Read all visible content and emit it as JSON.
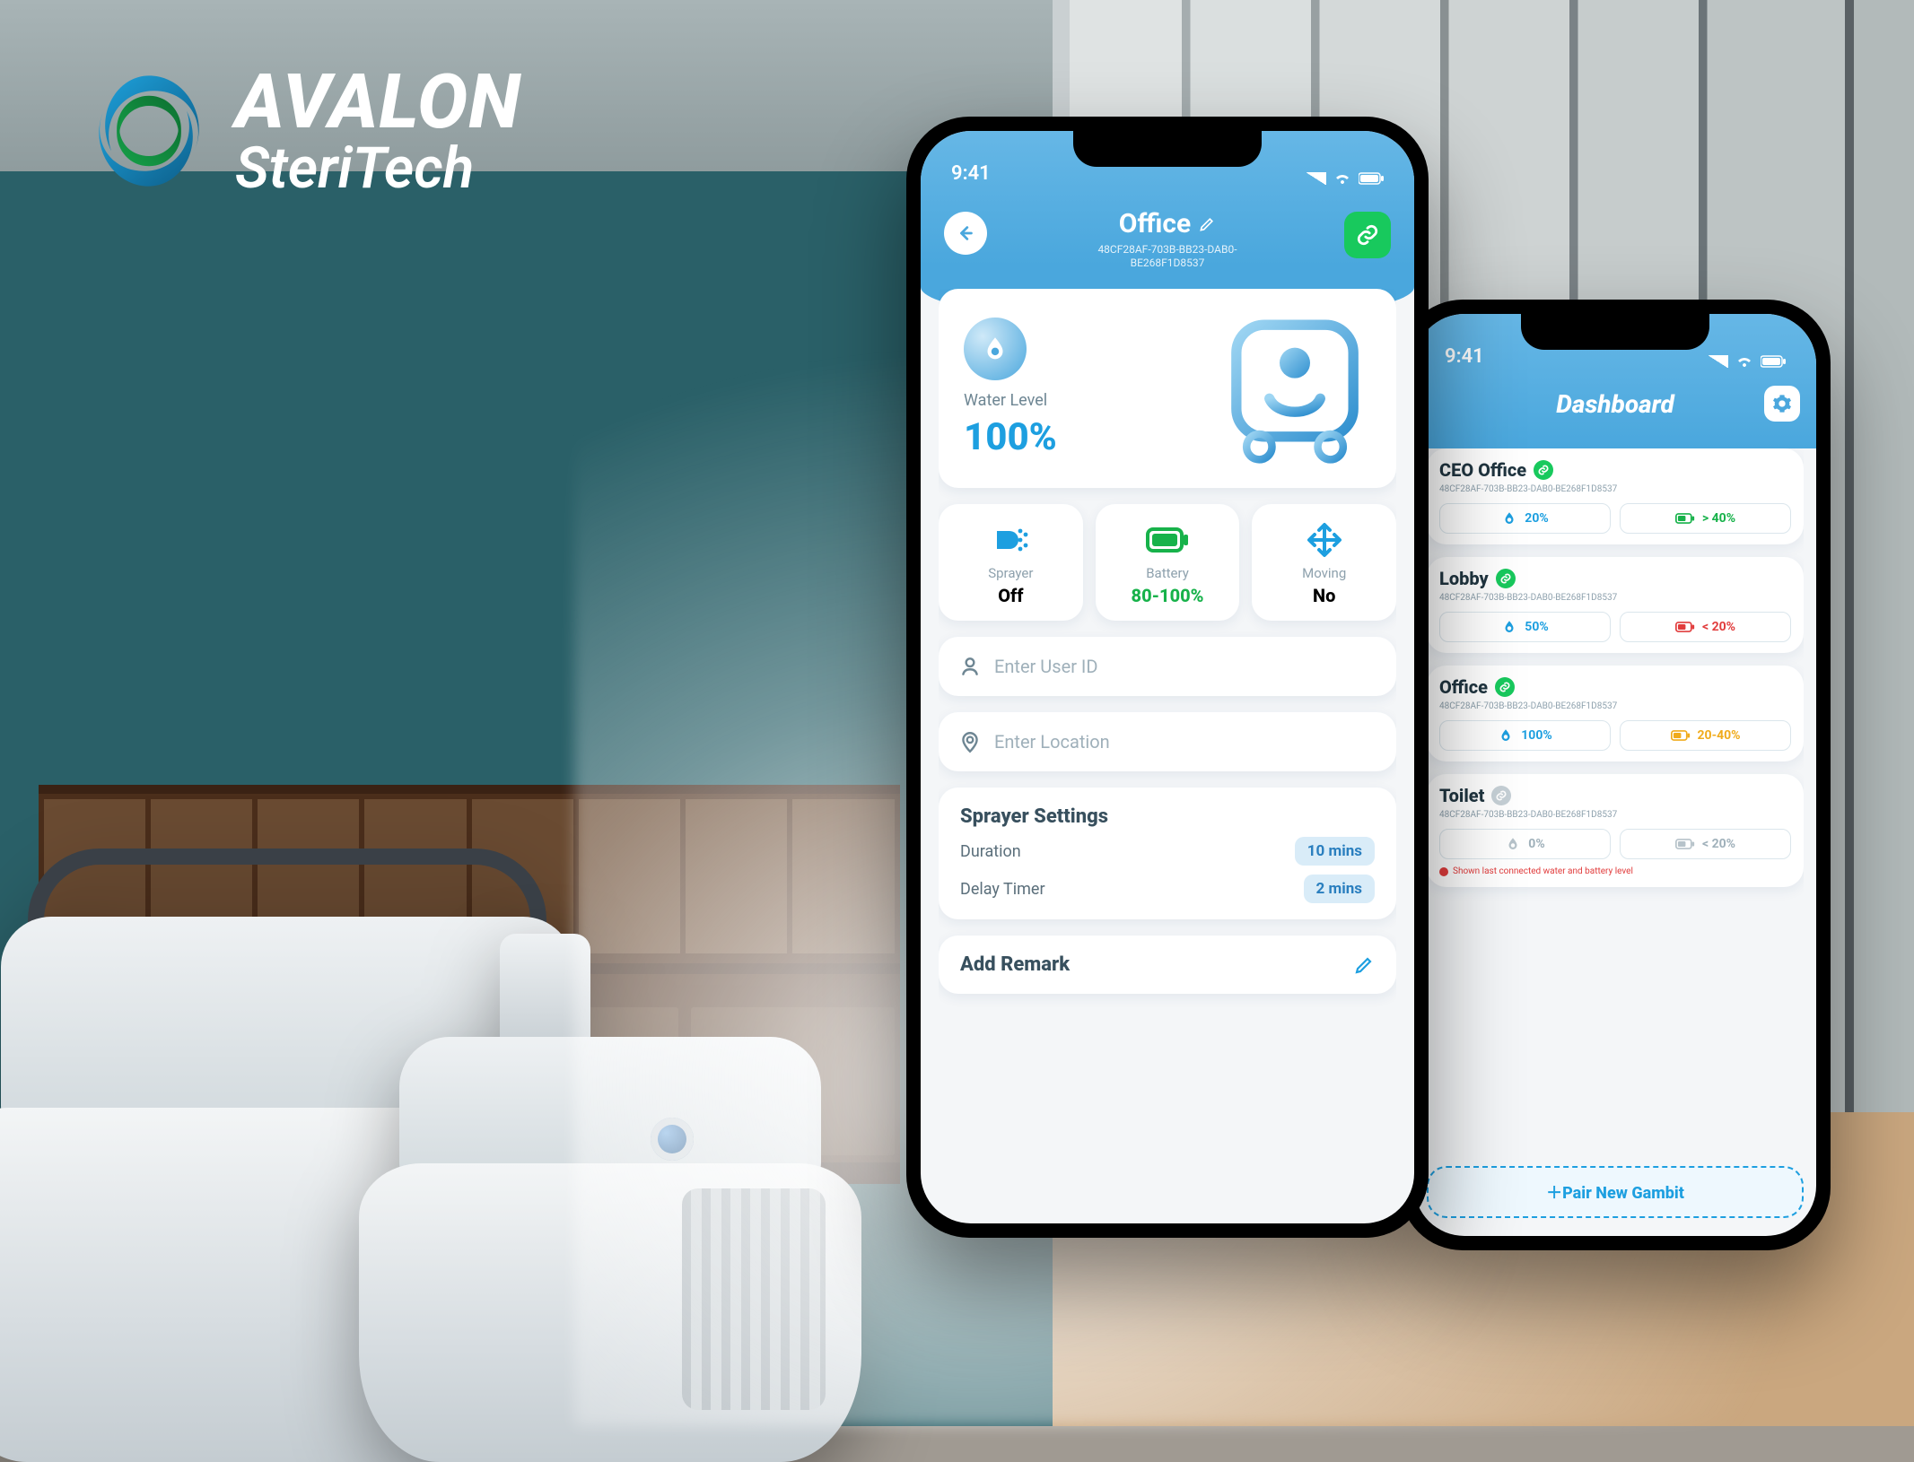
{
  "brand": {
    "line1": "AVALON",
    "line2": "SteriTech"
  },
  "statusbar": {
    "time": "9:41"
  },
  "front": {
    "title": "Office",
    "device_id_line1": "48CF28AF-703B-BB23-DAB0-",
    "device_id_line2": "BE268F1D8537",
    "water": {
      "label": "Water Level",
      "value": "100%"
    },
    "stats": {
      "sprayer": {
        "label": "Sprayer",
        "value": "Off"
      },
      "battery": {
        "label": "Battery",
        "value": "80-100%"
      },
      "moving": {
        "label": "Moving",
        "value": "No"
      }
    },
    "user_placeholder": "Enter User ID",
    "location_placeholder": "Enter Location",
    "settings": {
      "heading": "Sprayer Settings",
      "duration_label": "Duration",
      "duration_value": "10 mins",
      "delay_label": "Delay Timer",
      "delay_value": "2 mins"
    },
    "remark_label": "Add Remark"
  },
  "back": {
    "title": "Dashboard",
    "devices": [
      {
        "name": "CEO Office",
        "linked": true,
        "id": "48CF28AF-703B-BB23-DAB0-BE268F1D8537",
        "water": "20%",
        "water_color": "blue",
        "battery": "> 40%",
        "battery_color": "green"
      },
      {
        "name": "Lobby",
        "linked": true,
        "id": "48CF28AF-703B-BB23-DAB0-BE268F1D8537",
        "water": "50%",
        "water_color": "blue",
        "battery": "< 20%",
        "battery_color": "red"
      },
      {
        "name": "Office",
        "linked": true,
        "id": "48CF28AF-703B-BB23-DAB0-BE268F1D8537",
        "water": "100%",
        "water_color": "blue",
        "battery": "20-40%",
        "battery_color": "amber"
      },
      {
        "name": "Toilet",
        "linked": false,
        "id": "48CF28AF-703B-BB23-DAB0-BE268F1D8537",
        "water": "0%",
        "water_color": "grey",
        "battery": "< 20%",
        "battery_color": "grey",
        "warning": "Shown last connected water and battery level"
      }
    ],
    "pair_label": "Pair New Gambit"
  }
}
